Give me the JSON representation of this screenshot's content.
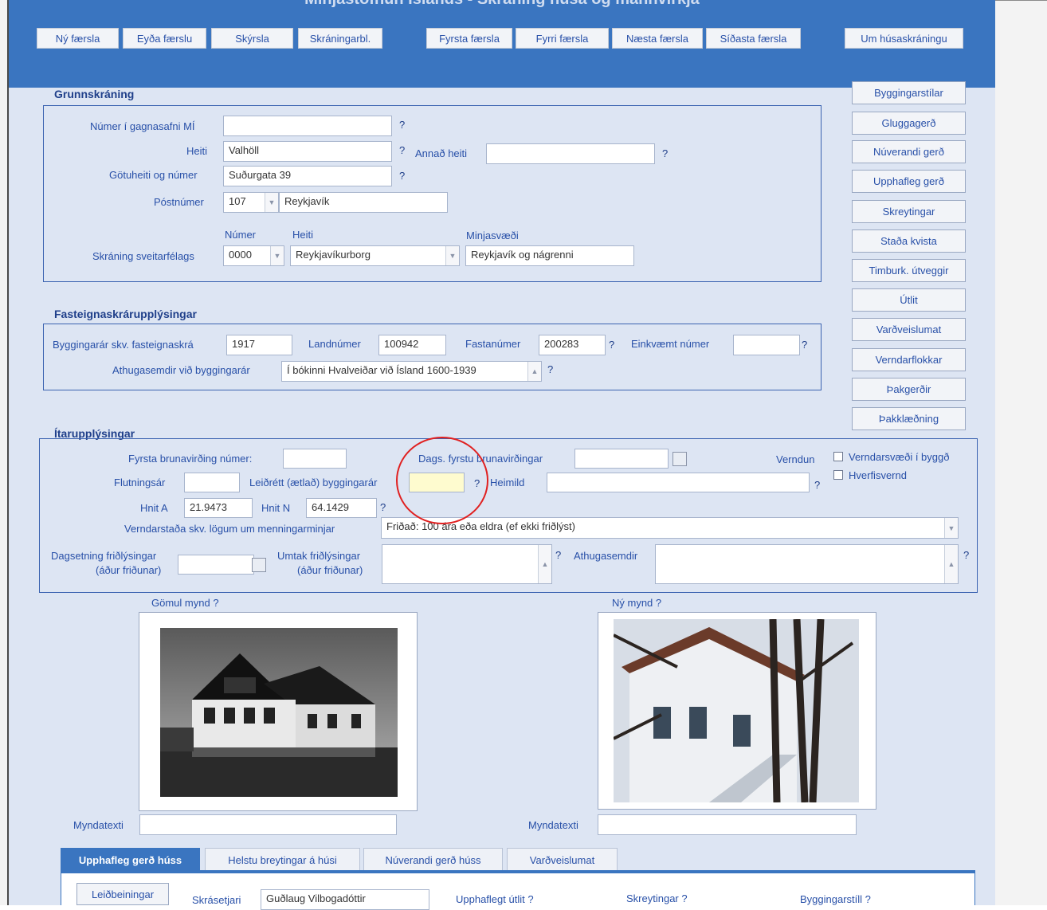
{
  "header": {
    "title": "Minjastofnun Íslands - Skráning húsa og mannvirkja",
    "buttons": [
      "Ný færsla",
      "Eyða færslu",
      "Skýrsla",
      "Skráningarbl.",
      "Fyrsta færsla",
      "Fyrri færsla",
      "Næsta færsla",
      "Síðasta færsla",
      "Um húsaskráningu"
    ]
  },
  "side_buttons": [
    "Byggingarstílar",
    "Gluggagerð",
    "Núverandi gerð",
    "Upphafleg gerð",
    "Skreytingar",
    "Staða kvista",
    "Timburk. útveggir",
    "Útlit",
    "Varðveislumat",
    "Verndarflokkar",
    "Þakgerðir",
    "Þakklæðning"
  ],
  "grunn": {
    "title": "Grunnskráning",
    "numer_label": "Númer í gagnasafni MÍ",
    "numer_value": "",
    "heiti_label": "Heiti",
    "heiti_value": "Valhöll",
    "annad_label": "Annað heiti",
    "annad_value": "",
    "gata_label": "Götuheiti og númer",
    "gata_value": "Suðurgata 39",
    "post_label": "Póstnúmer",
    "post_value": "107",
    "post_city": "Reykjavík",
    "col_numer": "Númer",
    "col_heiti": "Heiti",
    "col_minja": "Minjasvæði",
    "svf_label": "Skráning sveitarfélags",
    "svf_numer": "0000",
    "svf_heiti": "Reykjavíkurborg",
    "svf_minja": "Reykjavík og nágrenni"
  },
  "fast": {
    "title": "Fasteignaskrárupplýsingar",
    "bygg_label": "Byggingarár skv. fasteignaskrá",
    "bygg_value": "1917",
    "land_label": "Landnúmer",
    "land_value": "100942",
    "fasta_label": "Fastanúmer",
    "fasta_value": "200283",
    "eink_label": "Einkvæmt númer",
    "eink_value": "",
    "aths_label": "Athugasemdir við byggingarár",
    "aths_value": "Í bókinni Hvalveiðar við Ísland 1600-1939"
  },
  "itar": {
    "title": "Ítarupplýsingar",
    "bruna_label": "Fyrsta brunavirðing númer:",
    "bruna_value": "",
    "dags_label": "Dags. fyrstu brunavirðingar",
    "dags_value": "",
    "verndun_label": "Verndun",
    "vernd1": "Verndarsvæði í byggð",
    "vernd2": "Hverfisvernd",
    "flutn_label": "Flutningsár",
    "flutn_value": "",
    "leidr_label": "Leiðrétt (ætlað) byggingarár",
    "leidr_value": "",
    "heimild_label": "Heimild",
    "heimild_value": "",
    "hnita_label": "Hnit A",
    "hnita_value": "21.9473",
    "hnitn_label": "Hnit N",
    "hnitn_value": "64.1429",
    "vstada_label": "Verndarstaða skv. lögum um menningarminjar",
    "vstada_value": "Friðað: 100 ára eða eldra (ef ekki friðlýst)",
    "dagsf_label1": "Dagsetning friðlýsingar",
    "dagsf_label2": "(áður friðunar)",
    "umtak_label1": "Umtak friðlýsingar",
    "umtak_label2": "(áður friðunar)",
    "athug_label": "Athugasemdir"
  },
  "photos": {
    "old_label": "Gömul mynd",
    "new_label": "Ný mynd",
    "caption_label": "Myndatexti"
  },
  "tabs": [
    "Upphafleg gerð húss",
    "Helstu breytingar á húsi",
    "Núverandi gerð húss",
    "Varðveislumat"
  ],
  "bottom": {
    "leidb": "Leiðbeiningar",
    "skras_label": "Skrásetjari",
    "skras_value": "Guðlaug Vilbogadóttir",
    "upph_label": "Upphaflegt útlit",
    "skreyt_label": "Skreytingar",
    "bstil_label": "Byggingarstíll"
  },
  "q": "?"
}
